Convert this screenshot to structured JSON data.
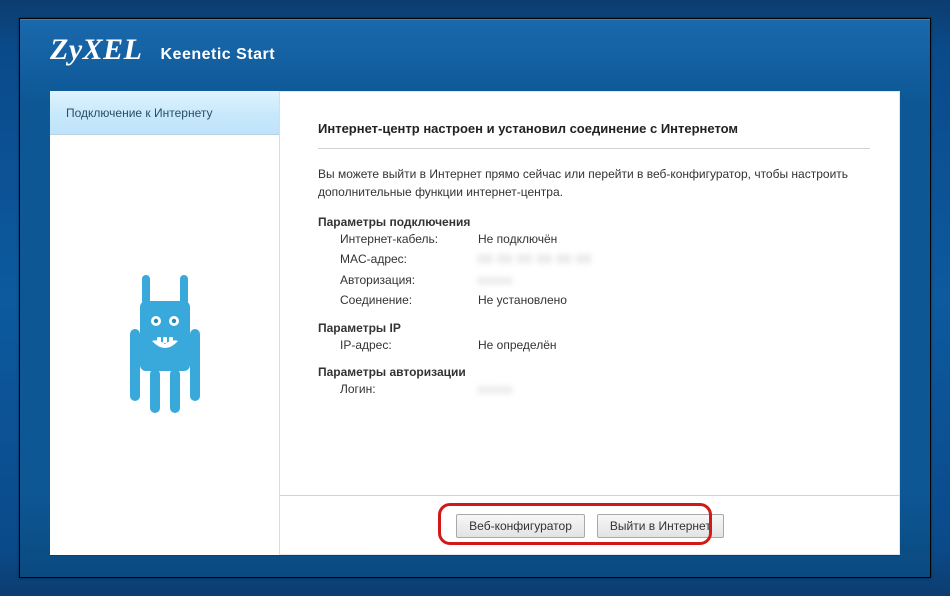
{
  "header": {
    "brand": "ZyXEL",
    "model": "Keenetic Start"
  },
  "sidebar": {
    "tab_label": "Подключение к Интернету"
  },
  "main": {
    "title": "Интернет-центр настроен и установил соединение с Интернетом",
    "intro": "Вы можете выйти в Интернет прямо сейчас или перейти в веб-конфигуратор, чтобы настроить дополнительные функции интернет-центра.",
    "sections": {
      "connection": {
        "title": "Параметры подключения",
        "cable_label": "Интернет-кабель:",
        "cable_value": "Не подключён",
        "mac_label": "MAC-адрес:",
        "mac_value": "",
        "auth_label": "Авторизация:",
        "auth_value": "",
        "conn_label": "Соединение:",
        "conn_value": "Не установлено"
      },
      "ip": {
        "title": "Параметры IP",
        "ip_label": "IP-адрес:",
        "ip_value": "Не определён"
      },
      "authz": {
        "title": "Параметры авторизации",
        "login_label": "Логин:",
        "login_value": ""
      }
    }
  },
  "footer": {
    "configurator_label": "Веб-конфигуратор",
    "go_online_label": "Выйти в Интернет"
  }
}
